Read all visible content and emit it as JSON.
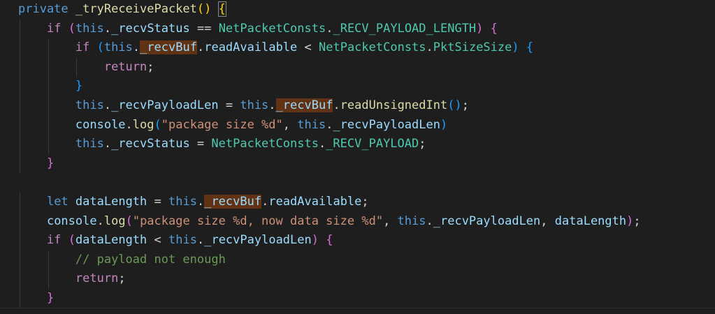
{
  "lines": [
    [
      [
        "kw",
        "private"
      ],
      [
        "punc",
        " "
      ],
      [
        "fn",
        "_tryReceivePacket"
      ],
      [
        "b1",
        "()"
      ],
      [
        "punc",
        " "
      ],
      [
        "b1bm",
        "{"
      ]
    ],
    [
      [
        "punc",
        "    "
      ],
      [
        "ctl",
        "if"
      ],
      [
        "punc",
        " "
      ],
      [
        "b2",
        "("
      ],
      [
        "kw",
        "this"
      ],
      [
        "punc",
        "."
      ],
      [
        "var",
        "_recvStatus"
      ],
      [
        "punc",
        " == "
      ],
      [
        "typ",
        "NetPacketConsts"
      ],
      [
        "punc",
        "."
      ],
      [
        "typ",
        "_RECV_PAYLOAD_LENGTH"
      ],
      [
        "b2",
        ")"
      ],
      [
        "punc",
        " "
      ],
      [
        "b2",
        "{"
      ]
    ],
    [
      [
        "punc",
        "        "
      ],
      [
        "ctl",
        "if"
      ],
      [
        "punc",
        " "
      ],
      [
        "b3",
        "("
      ],
      [
        "kw",
        "this"
      ],
      [
        "punc",
        "."
      ],
      [
        "varhl",
        "_recvBuf"
      ],
      [
        "punc",
        "."
      ],
      [
        "var",
        "readAvailable"
      ],
      [
        "punc",
        " < "
      ],
      [
        "typ",
        "NetPacketConsts"
      ],
      [
        "punc",
        "."
      ],
      [
        "typ",
        "PktSizeSize"
      ],
      [
        "b3",
        ")"
      ],
      [
        "punc",
        " "
      ],
      [
        "b3",
        "{"
      ]
    ],
    [
      [
        "punc",
        "            "
      ],
      [
        "ctl",
        "return"
      ],
      [
        "punc",
        ";"
      ]
    ],
    [
      [
        "punc",
        "        "
      ],
      [
        "b3",
        "}"
      ]
    ],
    [
      [
        "punc",
        "        "
      ],
      [
        "kw",
        "this"
      ],
      [
        "punc",
        "."
      ],
      [
        "var",
        "_recvPayloadLen"
      ],
      [
        "punc",
        " = "
      ],
      [
        "kw",
        "this"
      ],
      [
        "punc",
        "."
      ],
      [
        "varhl",
        "_recvBuf"
      ],
      [
        "punc",
        "."
      ],
      [
        "fn",
        "readUnsignedInt"
      ],
      [
        "b3",
        "()"
      ],
      [
        "punc",
        ";"
      ]
    ],
    [
      [
        "punc",
        "        "
      ],
      [
        "var",
        "console"
      ],
      [
        "punc",
        "."
      ],
      [
        "fn",
        "log"
      ],
      [
        "b3",
        "("
      ],
      [
        "str",
        "\"package size %d\""
      ],
      [
        "punc",
        ", "
      ],
      [
        "kw",
        "this"
      ],
      [
        "punc",
        "."
      ],
      [
        "var",
        "_recvPayloadLen"
      ],
      [
        "b3",
        ")"
      ]
    ],
    [
      [
        "punc",
        "        "
      ],
      [
        "kw",
        "this"
      ],
      [
        "punc",
        "."
      ],
      [
        "var",
        "_recvStatus"
      ],
      [
        "punc",
        " = "
      ],
      [
        "typ",
        "NetPacketConsts"
      ],
      [
        "punc",
        "."
      ],
      [
        "typ",
        "_RECV_PAYLOAD"
      ],
      [
        "punc",
        ";"
      ]
    ],
    [
      [
        "punc",
        "    "
      ],
      [
        "b2",
        "}"
      ]
    ],
    [
      [
        "punc",
        ""
      ]
    ],
    [
      [
        "punc",
        "    "
      ],
      [
        "kw",
        "let"
      ],
      [
        "punc",
        " "
      ],
      [
        "var",
        "dataLength"
      ],
      [
        "punc",
        " = "
      ],
      [
        "kw",
        "this"
      ],
      [
        "punc",
        "."
      ],
      [
        "varhl",
        "_recvBuf"
      ],
      [
        "punc",
        "."
      ],
      [
        "var",
        "readAvailable"
      ],
      [
        "punc",
        ";"
      ]
    ],
    [
      [
        "punc",
        "    "
      ],
      [
        "var",
        "console"
      ],
      [
        "punc",
        "."
      ],
      [
        "fn",
        "log"
      ],
      [
        "b2",
        "("
      ],
      [
        "str",
        "\"package size %d, now data size %d\""
      ],
      [
        "punc",
        ", "
      ],
      [
        "kw",
        "this"
      ],
      [
        "punc",
        "."
      ],
      [
        "var",
        "_recvPayloadLen"
      ],
      [
        "punc",
        ", "
      ],
      [
        "var",
        "dataLength"
      ],
      [
        "b2",
        ")"
      ],
      [
        "punc",
        ";"
      ]
    ],
    [
      [
        "punc",
        "    "
      ],
      [
        "ctl",
        "if"
      ],
      [
        "punc",
        " "
      ],
      [
        "b2",
        "("
      ],
      [
        "var",
        "dataLength"
      ],
      [
        "punc",
        " < "
      ],
      [
        "kw",
        "this"
      ],
      [
        "punc",
        "."
      ],
      [
        "var",
        "_recvPayloadLen"
      ],
      [
        "b2",
        ")"
      ],
      [
        "punc",
        " "
      ],
      [
        "b2",
        "{"
      ]
    ],
    [
      [
        "punc",
        "        "
      ],
      [
        "cmt",
        "// payload not enough"
      ]
    ],
    [
      [
        "punc",
        "        "
      ],
      [
        "ctl",
        "return"
      ],
      [
        "punc",
        ";"
      ]
    ],
    [
      [
        "punc",
        "    "
      ],
      [
        "b2",
        "}"
      ]
    ]
  ]
}
